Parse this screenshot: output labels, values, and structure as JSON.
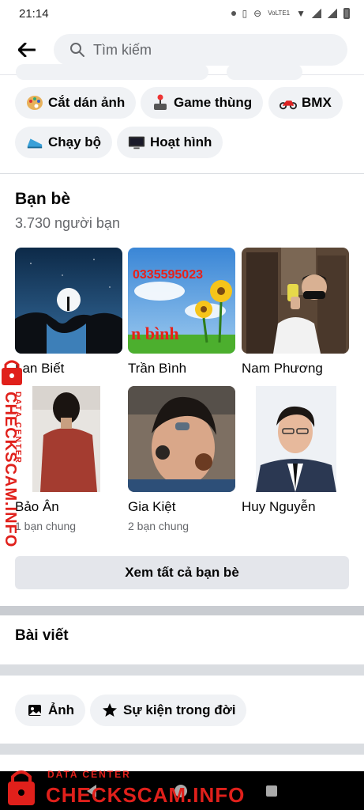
{
  "status_bar": {
    "time": "21:14",
    "network_label": "VoLTE1"
  },
  "search": {
    "placeholder": "Tìm kiếm"
  },
  "interest_chips": [
    {
      "label": "Cắt dán ảnh",
      "icon": "palette-icon"
    },
    {
      "label": "Game thùng",
      "icon": "arcade-joystick-icon"
    },
    {
      "label": "BMX",
      "icon": "motorbike-icon"
    },
    {
      "label": "Chạy bộ",
      "icon": "running-shoe-icon"
    },
    {
      "label": "Hoạt hình",
      "icon": "tv-screen-icon"
    }
  ],
  "friends_section": {
    "title": "Bạn bè",
    "count_text": "3.730 người bạn",
    "friends": [
      {
        "name": "Lan Biết",
        "mutual": ""
      },
      {
        "name": "Trần Bình",
        "mutual": ""
      },
      {
        "name": "Nam Phương",
        "mutual": ""
      },
      {
        "name": "Bảo Ân",
        "mutual": "1 bạn chung"
      },
      {
        "name": "Gia Kiệt",
        "mutual": "2 bạn chung"
      },
      {
        "name": "Huy Nguyễn",
        "mutual": ""
      }
    ],
    "photo_overlay_phone": "0335595023",
    "photo_overlay_name": "n bình",
    "see_all_label": "Xem tất cả bạn bè"
  },
  "posts_section": {
    "title": "Bài viết",
    "chips": [
      {
        "label": "Ảnh",
        "icon": "photo-icon"
      },
      {
        "label": "Sự kiện trong đời",
        "icon": "star-icon"
      }
    ]
  },
  "watermark": {
    "vertical_small": "DATA CENTER",
    "vertical_big": "CHECKSCAM.INFO",
    "bottom_small": "DATA CENTER",
    "bottom_big": "CHECKSCAM.INFO",
    "color": "#e0201b"
  }
}
